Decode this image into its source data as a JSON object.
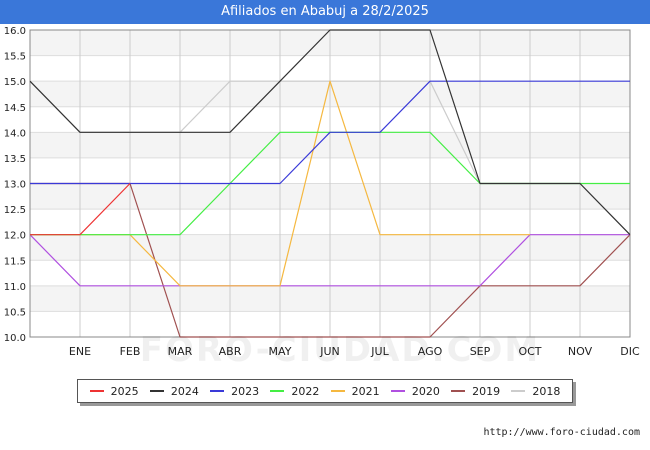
{
  "header": {
    "title": "Afiliados en Ababuj a 28/2/2025"
  },
  "watermark": "FORO-CIUDAD.COM",
  "footer": {
    "source": "http://www.foro-ciudad.com"
  },
  "chart_data": {
    "type": "line",
    "title": "Afiliados en Ababuj a 28/2/2025",
    "categories": [
      "",
      "ENE",
      "FEB",
      "MAR",
      "ABR",
      "MAY",
      "JUN",
      "JUL",
      "AGO",
      "SEP",
      "OCT",
      "NOV",
      "DIC"
    ],
    "ylim": [
      10.0,
      16.0
    ],
    "yticks": [
      "10.0",
      "10.5",
      "11.0",
      "11.5",
      "12.0",
      "12.5",
      "13.0",
      "13.5",
      "14.0",
      "14.5",
      "15.0",
      "15.5",
      "16.0"
    ],
    "grid": true,
    "legend_position": "bottom",
    "series": [
      {
        "name": "2018",
        "color": "#cccccc",
        "values": [
          15,
          14,
          14,
          14,
          15,
          15,
          15,
          15,
          15,
          13,
          13,
          13,
          12
        ]
      },
      {
        "name": "2019",
        "color": "#a05050",
        "values": [
          13,
          13,
          13,
          10,
          10,
          10,
          10,
          10,
          10,
          11,
          11,
          11,
          12
        ]
      },
      {
        "name": "2020",
        "color": "#b050e0",
        "values": [
          12,
          11,
          11,
          11,
          11,
          11,
          11,
          11,
          11,
          11,
          12,
          12,
          12
        ]
      },
      {
        "name": "2021",
        "color": "#f5b840",
        "values": [
          12,
          12,
          12,
          11,
          11,
          11,
          15,
          12,
          12,
          12,
          12,
          null,
          null
        ]
      },
      {
        "name": "2022",
        "color": "#44ee44",
        "values": [
          12,
          12,
          12,
          12,
          13,
          14,
          14,
          14,
          14,
          13,
          13,
          13,
          13
        ]
      },
      {
        "name": "2023",
        "color": "#3a3ad8",
        "values": [
          13,
          13,
          13,
          13,
          13,
          13,
          14,
          14,
          15,
          15,
          15,
          15,
          15
        ]
      },
      {
        "name": "2024",
        "color": "#333333",
        "values": [
          15,
          14,
          14,
          14,
          14,
          15,
          16,
          16,
          16,
          13,
          13,
          13,
          12
        ]
      },
      {
        "name": "2025",
        "color": "#ee3333",
        "values": [
          12,
          12,
          13,
          null,
          null,
          null,
          null,
          null,
          null,
          null,
          null,
          null,
          null
        ]
      }
    ],
    "legend": [
      {
        "name": "2025",
        "color": "#ee3333"
      },
      {
        "name": "2024",
        "color": "#333333"
      },
      {
        "name": "2023",
        "color": "#3a3ad8"
      },
      {
        "name": "2022",
        "color": "#44ee44"
      },
      {
        "name": "2021",
        "color": "#f5b840"
      },
      {
        "name": "2020",
        "color": "#b050e0"
      },
      {
        "name": "2019",
        "color": "#a05050"
      },
      {
        "name": "2018",
        "color": "#cccccc"
      }
    ]
  }
}
